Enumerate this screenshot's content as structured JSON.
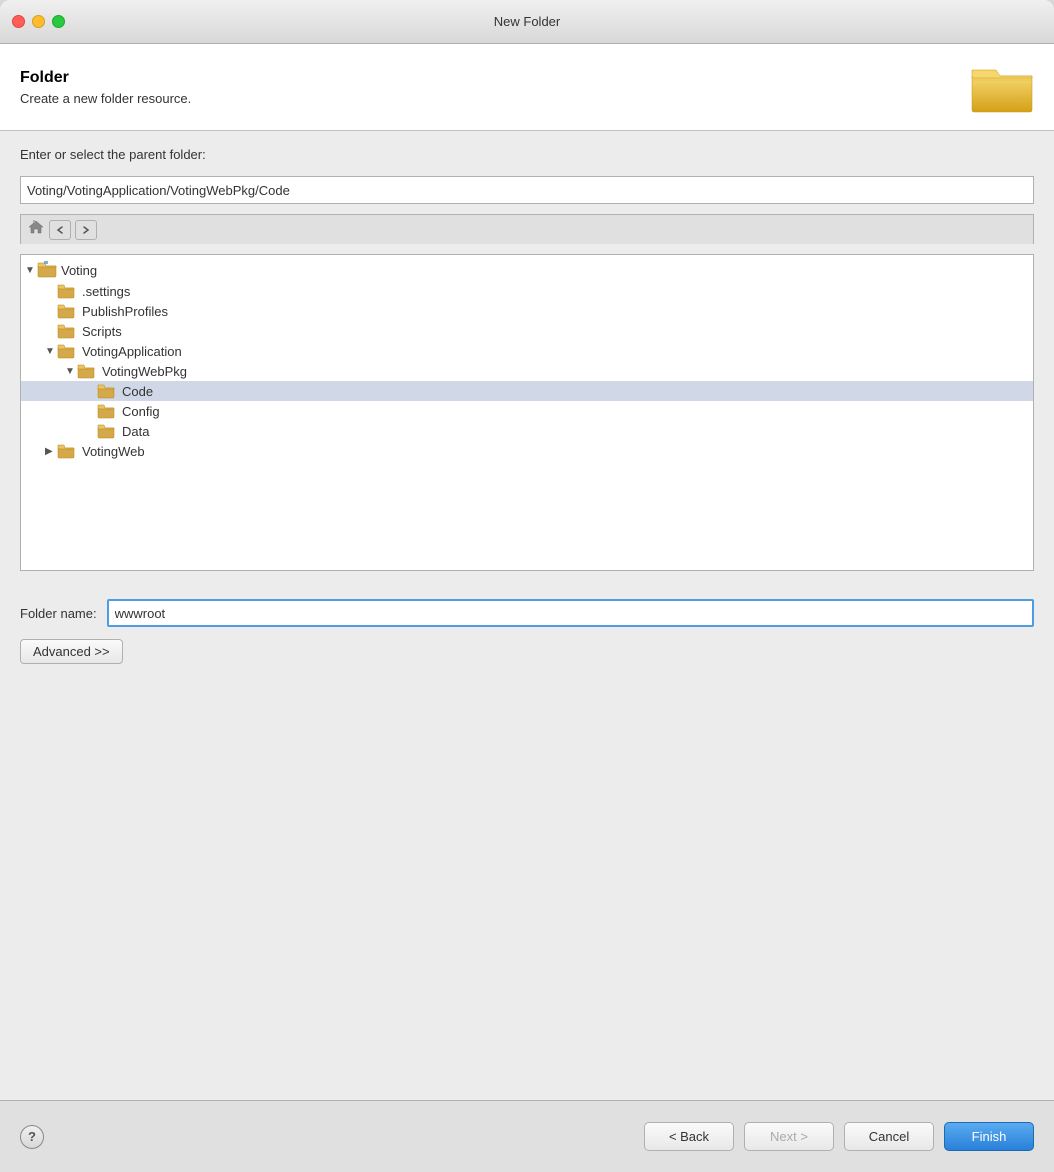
{
  "window": {
    "title": "New Folder"
  },
  "header": {
    "title": "Folder",
    "subtitle": "Create a new folder resource."
  },
  "form": {
    "parent_label": "Enter or select the parent folder:",
    "parent_path": "Voting/VotingApplication/VotingWebPkg/Code",
    "folder_name_label": "Folder name:",
    "folder_name_value": "wwwroot"
  },
  "tree": {
    "items": [
      {
        "id": "voting",
        "label": "Voting",
        "level": 0,
        "expanded": true,
        "has_arrow": true,
        "arrow": "▼",
        "type": "project"
      },
      {
        "id": "settings",
        "label": ".settings",
        "level": 1,
        "expanded": false,
        "has_arrow": false,
        "type": "folder"
      },
      {
        "id": "publishprofiles",
        "label": "PublishProfiles",
        "level": 1,
        "expanded": false,
        "has_arrow": false,
        "type": "folder"
      },
      {
        "id": "scripts",
        "label": "Scripts",
        "level": 1,
        "expanded": false,
        "has_arrow": false,
        "type": "folder"
      },
      {
        "id": "votingapplication",
        "label": "VotingApplication",
        "level": 1,
        "expanded": true,
        "has_arrow": true,
        "arrow": "▼",
        "type": "folder"
      },
      {
        "id": "votingwebpkg",
        "label": "VotingWebPkg",
        "level": 2,
        "expanded": true,
        "has_arrow": true,
        "arrow": "▼",
        "type": "folder"
      },
      {
        "id": "code",
        "label": "Code",
        "level": 3,
        "expanded": false,
        "has_arrow": false,
        "type": "folder",
        "selected": true
      },
      {
        "id": "config",
        "label": "Config",
        "level": 3,
        "expanded": false,
        "has_arrow": false,
        "type": "folder"
      },
      {
        "id": "data",
        "label": "Data",
        "level": 3,
        "expanded": false,
        "has_arrow": false,
        "type": "folder"
      },
      {
        "id": "votingweb",
        "label": "VotingWeb",
        "level": 1,
        "expanded": false,
        "has_arrow": true,
        "arrow": "▶",
        "type": "folder"
      }
    ]
  },
  "buttons": {
    "advanced": "Advanced >>",
    "back": "< Back",
    "next": "Next >",
    "cancel": "Cancel",
    "finish": "Finish",
    "help": "?"
  }
}
